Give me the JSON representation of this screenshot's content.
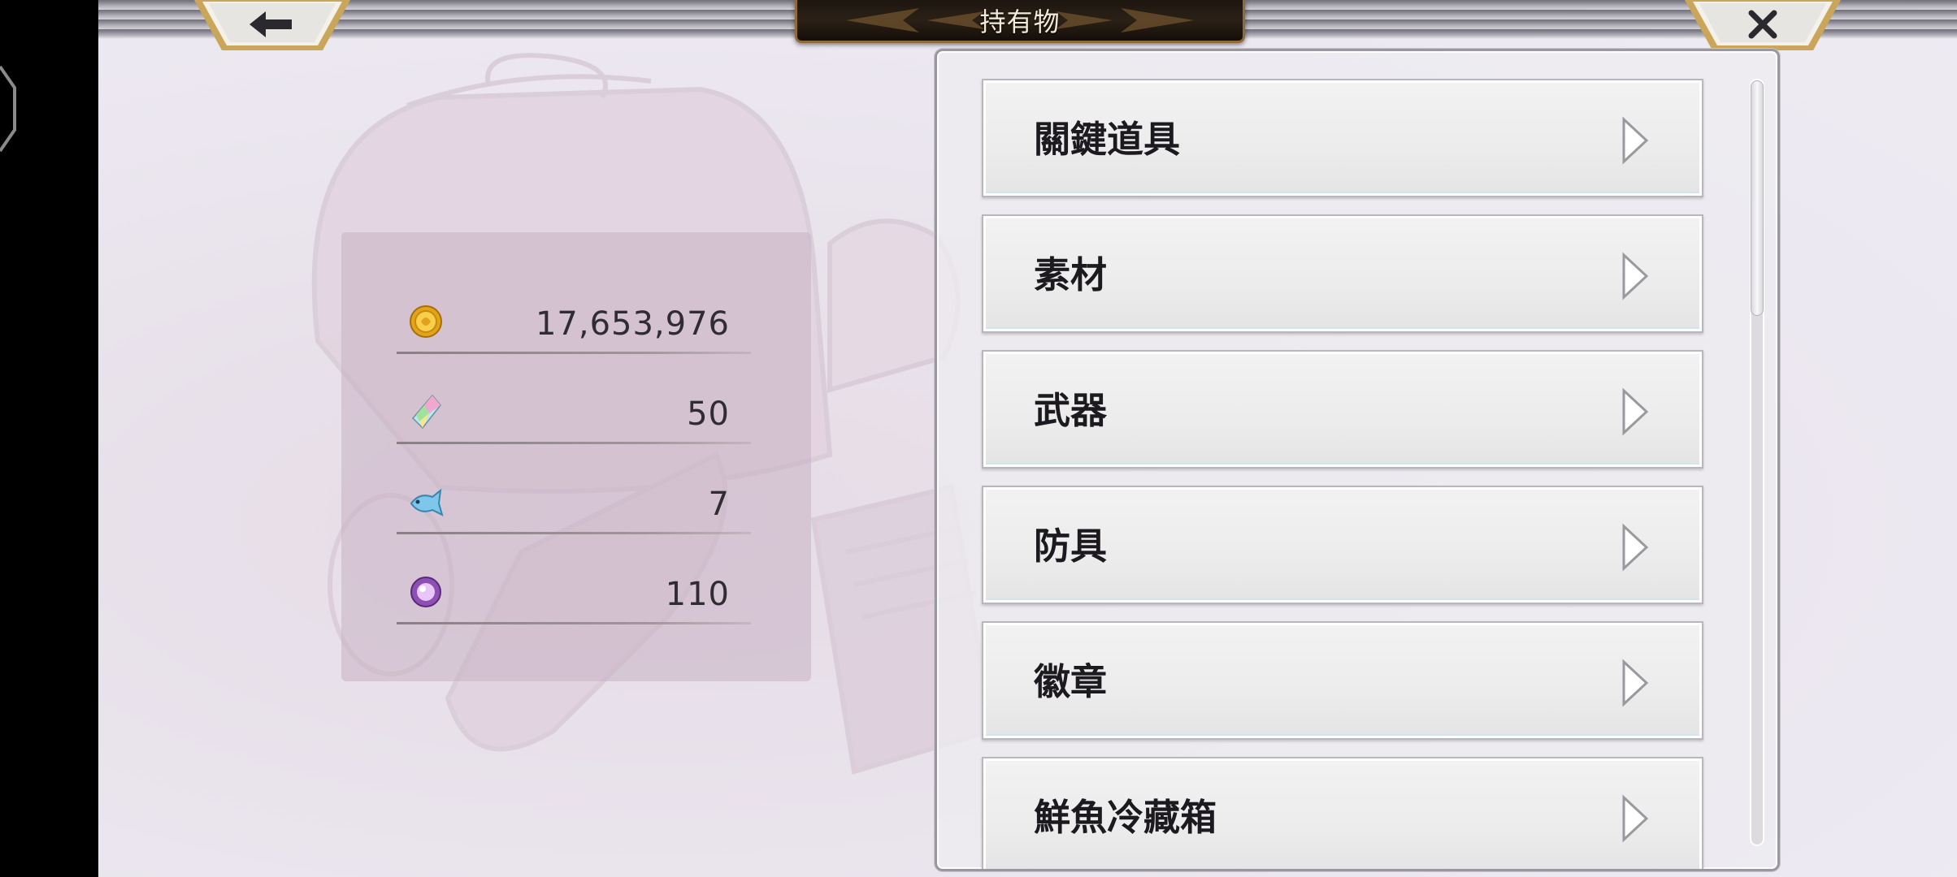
{
  "header": {
    "title": "持有物",
    "back_icon": "arrow-left-icon",
    "close_icon": "close-icon"
  },
  "currencies": [
    {
      "icon": "gold-coin-icon",
      "value": "17,653,976"
    },
    {
      "icon": "rainbow-crystal-icon",
      "value": "50"
    },
    {
      "icon": "blue-fish-icon",
      "value": "7"
    },
    {
      "icon": "purple-orb-icon",
      "value": "110"
    }
  ],
  "menu": {
    "items": [
      {
        "label": "關鍵道具"
      },
      {
        "label": "素材"
      },
      {
        "label": "武器"
      },
      {
        "label": "防具"
      },
      {
        "label": "徽章"
      },
      {
        "label": "鮮魚冷藏箱"
      }
    ]
  },
  "colors": {
    "background": "#ece8f1",
    "title_plate": "#2b2016",
    "title_border": "#8f6b3a",
    "menu_text": "#1c1a1f",
    "value_text": "#2f2c33"
  }
}
